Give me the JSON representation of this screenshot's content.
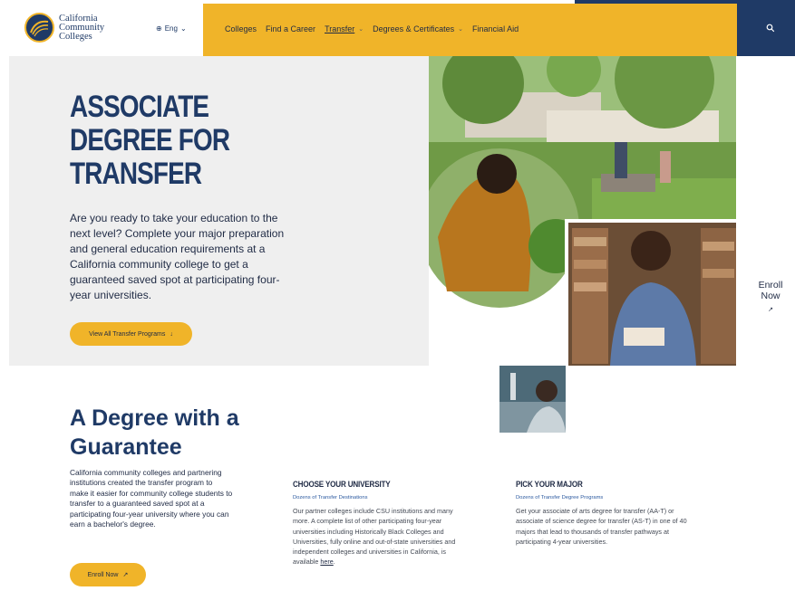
{
  "header": {
    "logo_lines": [
      "California",
      "Community",
      "Colleges"
    ],
    "language": "Eng",
    "nav": [
      {
        "label": "Colleges"
      },
      {
        "label": "Find a Career"
      },
      {
        "label": "Transfer"
      },
      {
        "label": "Degrees & Certificates"
      },
      {
        "label": "Financial Aid"
      }
    ],
    "colors": {
      "yellow": "#f0b429",
      "navy": "#1f3a66"
    }
  },
  "hero": {
    "title_lines": [
      "ASSOCIATE",
      "DEGREE FOR",
      "TRANSFER"
    ],
    "body": "Are you ready to take your education to the next level? Complete your major preparation and general education requirements at a California community college to get a guaranteed saved spot at participating four-year universities.",
    "button_label": "View All Transfer Programs"
  },
  "side": {
    "enroll_line1": "Enroll",
    "enroll_line2": "Now"
  },
  "guarantee": {
    "title": "A Degree with a Guarantee",
    "body": "California community colleges and partnering institutions created the transfer program to make it easier for community college students to transfer to a guaranteed saved spot at a participating four-year university where you can earn a bachelor's degree.",
    "button_label": "Enroll Now"
  },
  "columns": [
    {
      "heading": "CHOOSE YOUR UNIVERSITY",
      "subheading": "Dozens of Transfer Destinations",
      "text": "Our partner colleges include CSU institutions and many more. A complete list of other participating four-year universities including Historically Black Colleges and Universities, fully online and out-of-state universities and independent colleges and universities in California, is available",
      "link": "here"
    },
    {
      "heading": "PICK YOUR MAJOR",
      "subheading": "Dozens of Transfer Degree Programs",
      "text": "Get your associate of arts degree for transfer (AA-T) or associate of science degree for transfer (AS-T) in one of 40 majors that lead to thousands of transfer pathways at participating 4-year universities."
    }
  ]
}
